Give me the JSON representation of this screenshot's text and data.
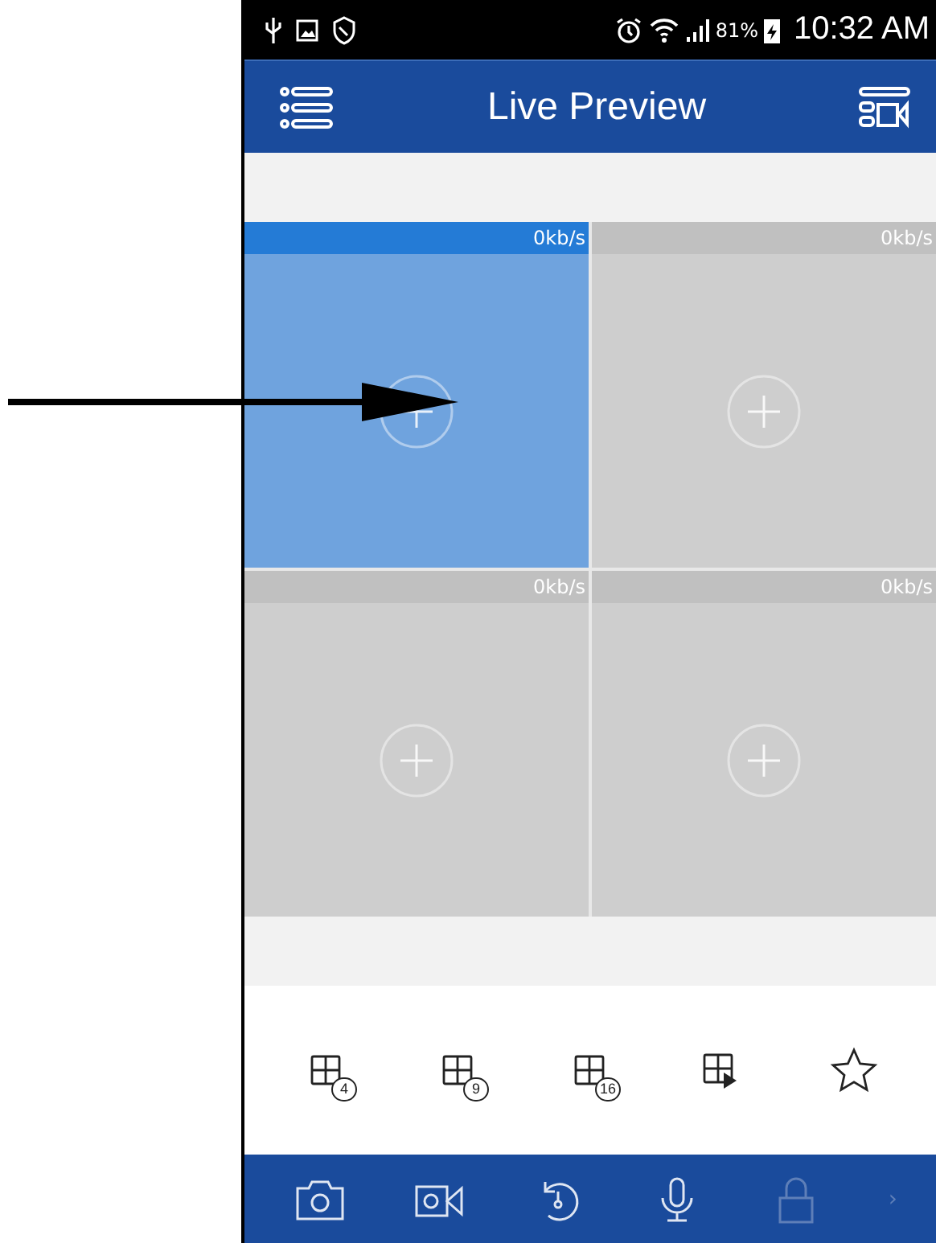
{
  "status_bar": {
    "battery": "81%",
    "time": "10:32 AM"
  },
  "header": {
    "title": "Live Preview"
  },
  "tiles": [
    {
      "rate": "0kb/s",
      "selected": true
    },
    {
      "rate": "0kb/s",
      "selected": false
    },
    {
      "rate": "0kb/s",
      "selected": false
    },
    {
      "rate": "0kb/s",
      "selected": false
    }
  ],
  "layout_toolbar": {
    "grid_badges": [
      "4",
      "9",
      "16"
    ]
  },
  "bottom_toolbar": {
    "items": [
      {
        "disabled": false
      },
      {
        "disabled": false
      },
      {
        "disabled": false
      },
      {
        "disabled": false
      },
      {
        "disabled": true
      }
    ],
    "more": "›"
  }
}
